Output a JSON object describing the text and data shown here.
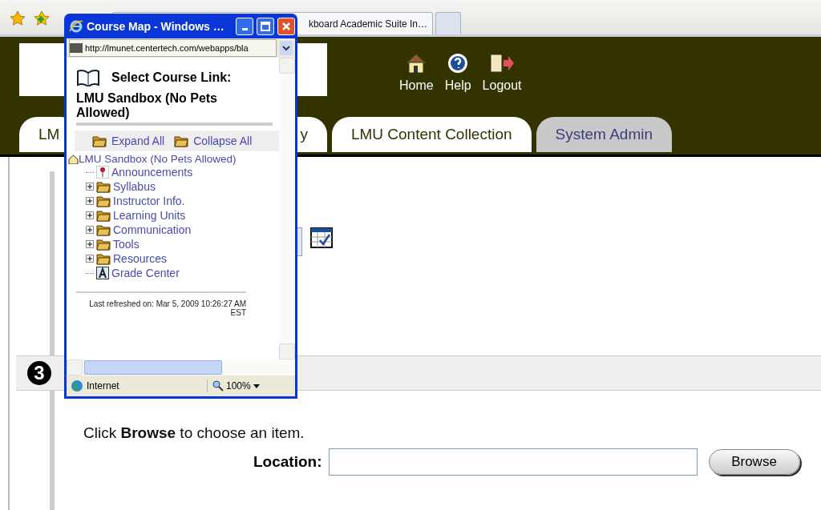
{
  "browser": {
    "tabs": [
      {
        "label": "kboard Academic Suite In…",
        "selected": true
      }
    ]
  },
  "header": {
    "nav": [
      {
        "label": "Home",
        "kind": "home"
      },
      {
        "label": "Help",
        "kind": "help"
      },
      {
        "label": "Logout",
        "kind": "logout"
      }
    ]
  },
  "tabs": [
    {
      "label": "LM",
      "selected": false
    },
    {
      "label": "y",
      "selected": false
    },
    {
      "label": "LMU Content Collection",
      "selected": false
    },
    {
      "label": "System Admin",
      "selected": true
    }
  ],
  "step": {
    "number": "3"
  },
  "form": {
    "instruction": "Click **Browse** to choose an item.",
    "location_label": "Location:",
    "browse_button": "Browse"
  },
  "popup": {
    "title": "Course Map - Windows …",
    "address": "http://lmunet.centertech.com/webapps/bla",
    "heading": "Select Course Link:",
    "course": "LMU Sandbox (No Pets Allowed)",
    "expand_all": "Expand All",
    "collapse_all": "Collapse All",
    "tree": {
      "label": "LMU Sandbox (No Pets Allowed)",
      "children": [
        {
          "label": "Announcements",
          "kind": "announcement"
        },
        {
          "label": "Syllabus",
          "kind": "folder",
          "expanded": false
        },
        {
          "label": "Instructor Info.",
          "kind": "folder",
          "expanded": false
        },
        {
          "label": "Learning Units",
          "kind": "folder",
          "expanded": false
        },
        {
          "label": "Communication",
          "kind": "folder",
          "expanded": false
        },
        {
          "label": "Tools",
          "kind": "folder",
          "expanded": false
        },
        {
          "label": "Resources",
          "kind": "folder",
          "expanded": false
        },
        {
          "label": "Grade Center",
          "kind": "grades"
        }
      ]
    },
    "refreshed": "Last refreshed on: Mar 5, 2009 10:26:27 AM EST",
    "zone": "Internet",
    "zoom": "100%"
  }
}
